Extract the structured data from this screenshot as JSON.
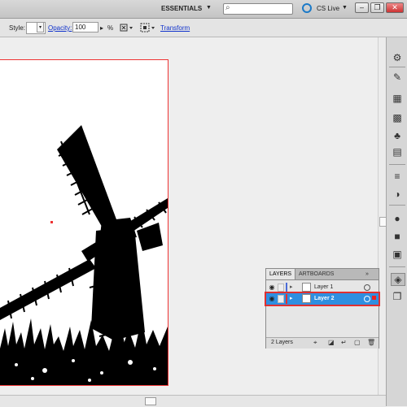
{
  "app_bar": {
    "workspace": "ESSENTIALS",
    "workspace_arrow": "▼",
    "search_placeholder": "",
    "search_glyph": "⌕",
    "cs_live": "CS Live",
    "cs_arrow": "▼",
    "min": "–",
    "restore": "❐",
    "close": "✕"
  },
  "control_bar": {
    "style_label": "Style:",
    "opacity_label": "Opacity:",
    "opacity_value": "100",
    "opacity_arrow": "▸",
    "opacity_unit": "%",
    "transform_label": "Transform",
    "dropdown_glyph": "▾"
  },
  "layers_panel": {
    "tabs": [
      "LAYERS",
      "ARTBOARDS"
    ],
    "menu_glyph": "»",
    "layers": [
      {
        "name": "Layer 1",
        "selected": false,
        "color": "#4a6bd8"
      },
      {
        "name": "Layer 2",
        "selected": true,
        "color": "#e03030"
      }
    ],
    "footer_count": "2 Layers"
  },
  "icons": {
    "eye": "👁",
    "triangle": "▸",
    "dock": [
      "gear-icon",
      "brush-icon",
      "swatch-icon",
      "grid-icon",
      "club-icon",
      "stack-icon",
      "lines-icon",
      "overlap-icon",
      "circle-icon",
      "square-icon",
      "box-icon",
      "layers-icon",
      "pages-icon"
    ]
  },
  "colors": {
    "artboard_border": "#e33333",
    "link": "#1133cc",
    "selection": "#2f8fe0"
  }
}
